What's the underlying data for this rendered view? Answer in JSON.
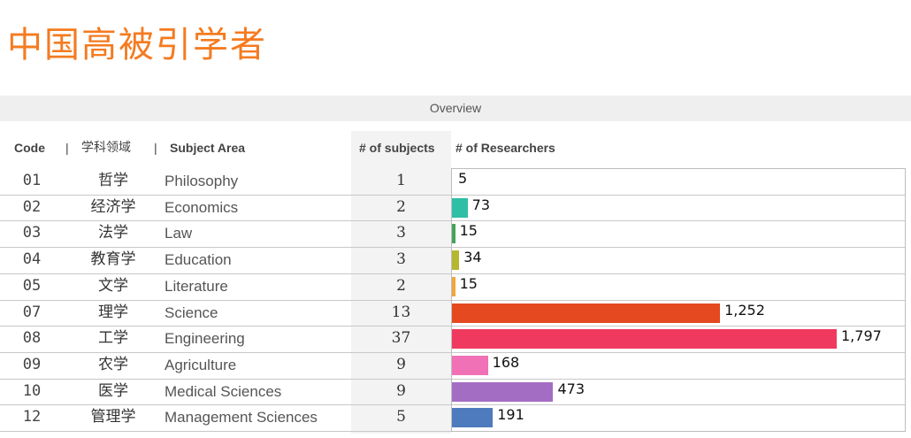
{
  "title": "中国高被引学者",
  "overview_label": "Overview",
  "headers": {
    "code": "Code",
    "sep1": "|",
    "subject_cn": "学科领域",
    "sep2": "|",
    "subject_en": "Subject Area",
    "num_subjects": "# of subjects",
    "num_researchers": "# of Researchers"
  },
  "rows": [
    {
      "code": "01",
      "cn": "哲学",
      "en": "Philosophy",
      "subjects": "1",
      "label": "5"
    },
    {
      "code": "02",
      "cn": "经济学",
      "en": "Economics",
      "subjects": "2",
      "label": "73"
    },
    {
      "code": "03",
      "cn": "法学",
      "en": "Law",
      "subjects": "3",
      "label": "15"
    },
    {
      "code": "04",
      "cn": "教育学",
      "en": "Education",
      "subjects": "3",
      "label": "34"
    },
    {
      "code": "05",
      "cn": "文学",
      "en": "Literature",
      "subjects": "2",
      "label": "15"
    },
    {
      "code": "07",
      "cn": "理学",
      "en": "Science",
      "subjects": "13",
      "label": "1,252"
    },
    {
      "code": "08",
      "cn": "工学",
      "en": "Engineering",
      "subjects": "37",
      "label": "1,797"
    },
    {
      "code": "09",
      "cn": "农学",
      "en": "Agriculture",
      "subjects": "9",
      "label": "168"
    },
    {
      "code": "10",
      "cn": "医学",
      "en": "Medical Sciences",
      "subjects": "9",
      "label": "473"
    },
    {
      "code": "12",
      "cn": "管理学",
      "en": "Management Sciences",
      "subjects": "5",
      "label": "191"
    }
  ],
  "chart_data": {
    "type": "bar",
    "orientation": "horizontal",
    "title": "",
    "xlabel": "# of Researchers",
    "ylabel": "",
    "categories": [
      "Philosophy",
      "Economics",
      "Law",
      "Education",
      "Literature",
      "Science",
      "Engineering",
      "Agriculture",
      "Medical Sciences",
      "Management Sciences"
    ],
    "values": [
      5,
      73,
      15,
      34,
      15,
      1252,
      1797,
      168,
      473,
      191
    ],
    "colors": [
      "#ffffff",
      "#2ebfa5",
      "#45a35b",
      "#b5b82e",
      "#f0a73d",
      "#e4491f",
      "#f0395f",
      "#f071b6",
      "#a46dc4",
      "#4e7bbd"
    ],
    "xlim": [
      0,
      1797
    ],
    "grid": false,
    "legend": "none"
  }
}
